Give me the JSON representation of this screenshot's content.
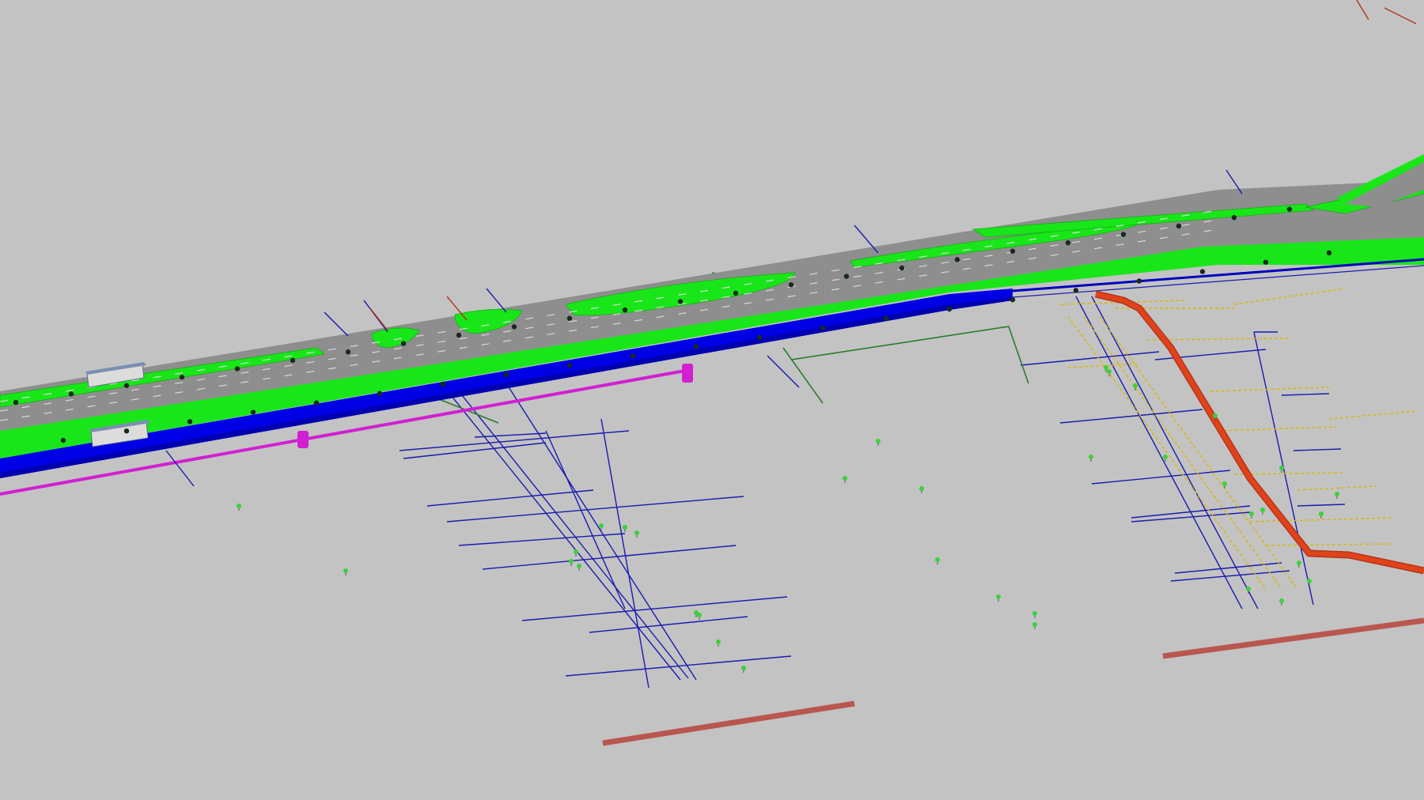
{
  "viewport": {
    "background": "#c3c3c3"
  },
  "scene": {
    "colors": {
      "road_asphalt": "#8e8e8e",
      "road_edge": "#7a7a7a",
      "lane_marking": "#d8d8d8",
      "median_green": "#19e619",
      "tree_canopy": "#1a2a1a",
      "small_tree_green": "#3bd13b",
      "drain_blue": "#0000e6",
      "drain_blue_dark": "#0000b0",
      "water_pipe_magenta": "#d11fd1",
      "gas_main_orange": "#e0431a",
      "sewer_pipe_brown": "#b9564f",
      "service_line_blue": "#1a1ab0",
      "service_line_yellow": "#d8b800",
      "service_line_green": "#2c7a2c",
      "bus_shelter": "#dcdcdc"
    },
    "layers": [
      "road-surface",
      "medians",
      "storm-drain",
      "water-main",
      "gas-main",
      "sewer-pipes",
      "service-lines",
      "trees",
      "bus-shelters"
    ]
  }
}
